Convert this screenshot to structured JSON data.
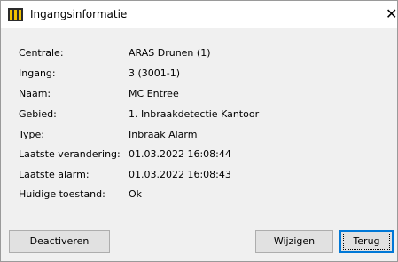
{
  "window": {
    "title": "Ingangsinformatie",
    "close_glyph": "✕",
    "icon": "app-icon"
  },
  "fields": [
    {
      "label": "Centrale:",
      "value": "ARAS Drunen (1)"
    },
    {
      "label": "Ingang:",
      "value": "3 (3001-1)"
    },
    {
      "label": "Naam:",
      "value": "MC Entree"
    },
    {
      "label": "Gebied:",
      "value": "1. Inbraakdetectie Kantoor"
    },
    {
      "label": "Type:",
      "value": "Inbraak Alarm"
    },
    {
      "label": "Laatste verandering:",
      "value": "01.03.2022 16:08:44"
    },
    {
      "label": "Laatste alarm:",
      "value": "01.03.2022 16:08:43"
    },
    {
      "label": "Huidige toestand:",
      "value": "Ok"
    }
  ],
  "buttons": {
    "deactivate": "Deactiveren",
    "edit": "Wijzigen",
    "back": "Terug"
  }
}
